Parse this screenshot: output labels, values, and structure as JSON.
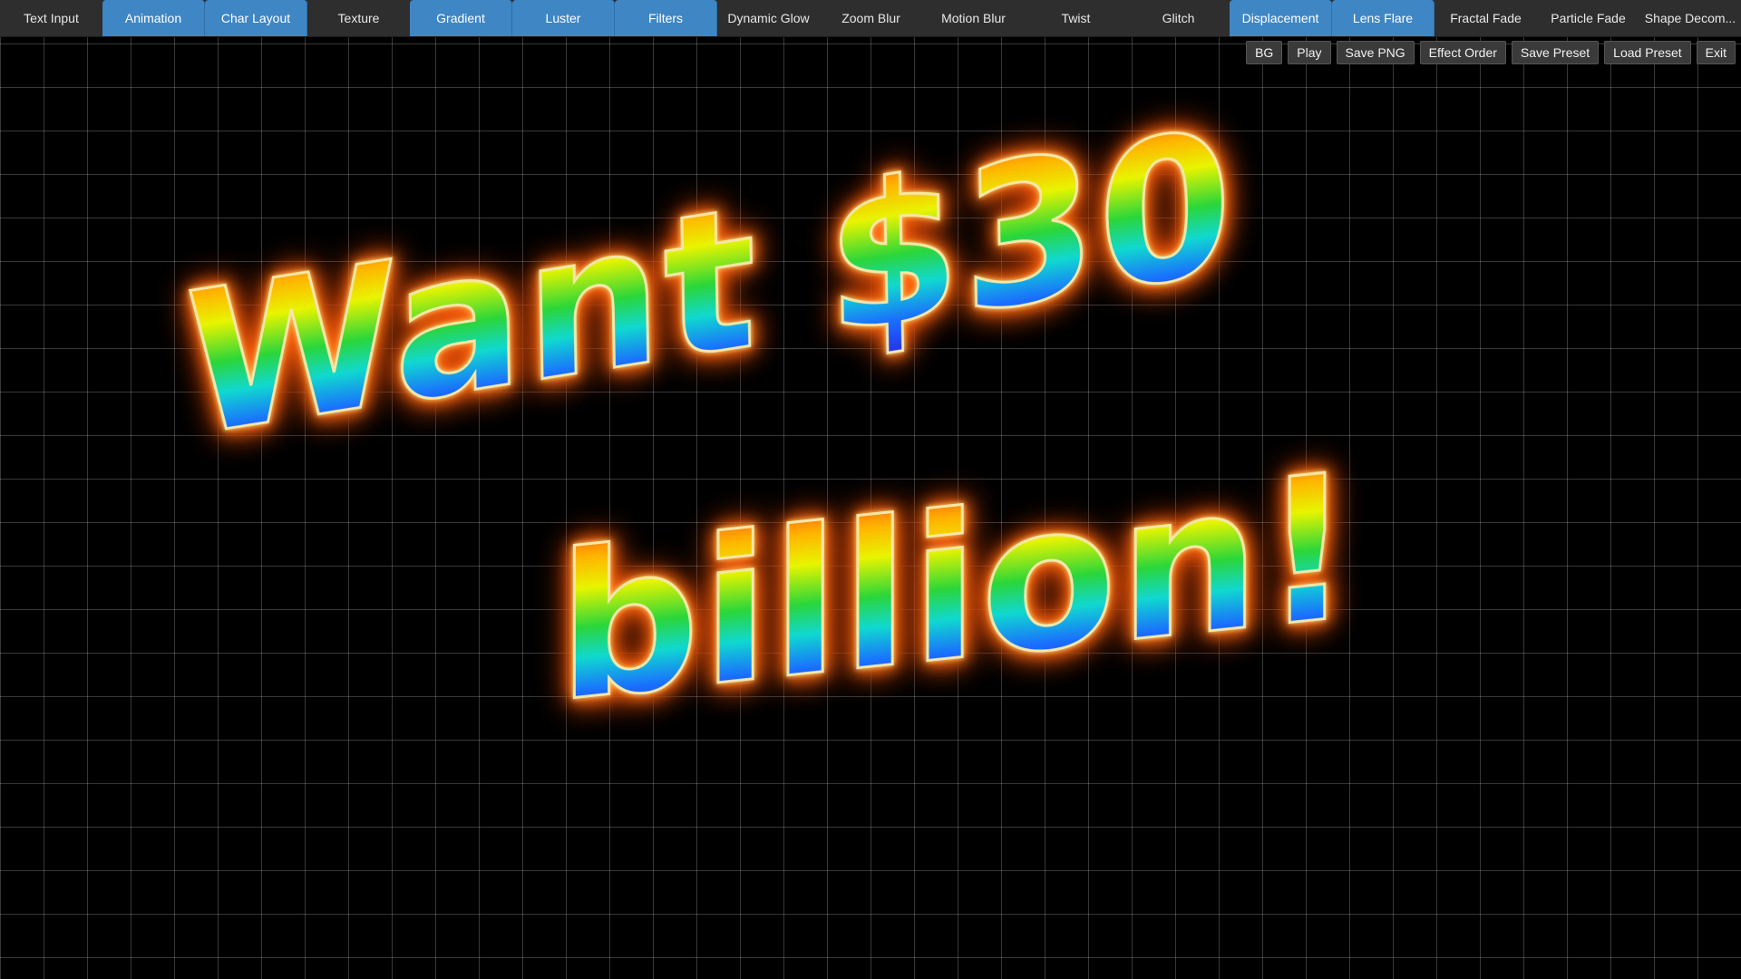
{
  "tabs": [
    {
      "label": "Text Input",
      "active": false
    },
    {
      "label": "Animation",
      "active": true
    },
    {
      "label": "Char Layout",
      "active": true
    },
    {
      "label": "Texture",
      "active": false
    },
    {
      "label": "Gradient",
      "active": true
    },
    {
      "label": "Luster",
      "active": true
    },
    {
      "label": "Filters",
      "active": true
    },
    {
      "label": "Dynamic Glow",
      "active": false
    },
    {
      "label": "Zoom Blur",
      "active": false
    },
    {
      "label": "Motion Blur",
      "active": false
    },
    {
      "label": "Twist",
      "active": false
    },
    {
      "label": "Glitch",
      "active": false
    },
    {
      "label": "Displacement",
      "active": true
    },
    {
      "label": "Lens Flare",
      "active": true
    },
    {
      "label": "Fractal Fade",
      "active": false
    },
    {
      "label": "Particle Fade",
      "active": false
    },
    {
      "label": "Shape Decom...",
      "active": false
    }
  ],
  "actions": {
    "bg": "BG",
    "play": "Play",
    "save_png": "Save PNG",
    "effect_order": "Effect Order",
    "save_preset": "Save Preset",
    "load_preset": "Load Preset",
    "exit": "Exit"
  },
  "canvas": {
    "line1": "Want $30",
    "line2": "billion!",
    "background": "#000000",
    "grid_color": "#ffffff",
    "gradient_colors": [
      "#ff3a1a",
      "#ffb400",
      "#e8f400",
      "#2ad63a",
      "#10d8d0",
      "#1a6cff",
      "#2a1ae0"
    ],
    "glow_color": "#ff7a1a",
    "outline_color": "#f6e7a8"
  },
  "colors": {
    "tabbar_bg": "#2e2e2e",
    "tab_active": "#3f86c4",
    "button_bg": "#3a3a3a"
  }
}
